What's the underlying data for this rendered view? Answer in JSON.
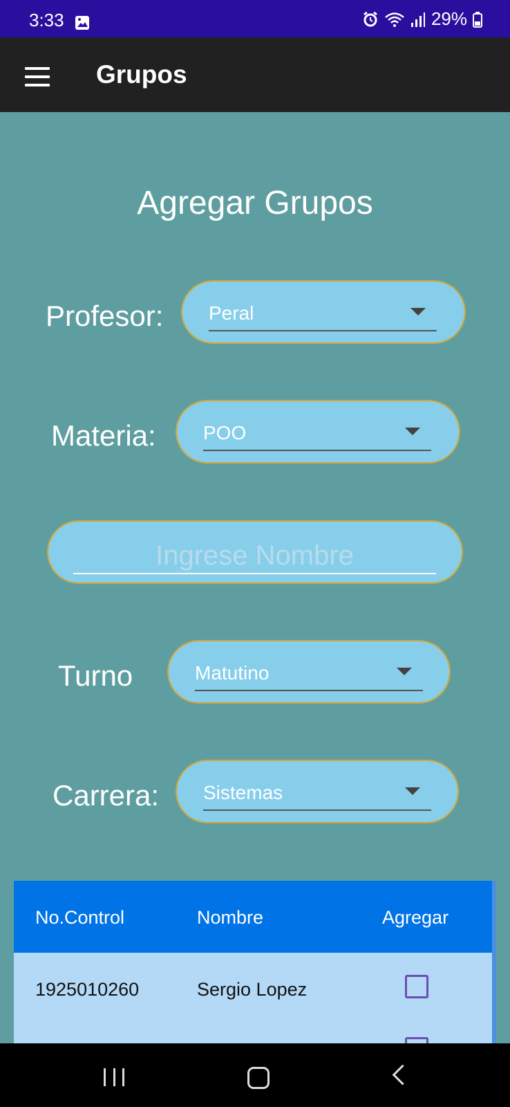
{
  "status": {
    "time": "3:33",
    "battery": "29%"
  },
  "app_bar": {
    "title": "Grupos"
  },
  "form": {
    "title": "Agregar Grupos",
    "profesor_label": "Profesor:",
    "profesor_value": "Peral",
    "materia_label": "Materia:",
    "materia_value": "POO",
    "nombre_placeholder": "Ingrese Nombre",
    "nombre_value": "",
    "turno_label": "Turno",
    "turno_value": "Matutino",
    "carrera_label": "Carrera:",
    "carrera_value": "Sistemas"
  },
  "table": {
    "headers": [
      "No.Control",
      "Nombre",
      "Agregar"
    ],
    "rows": [
      {
        "control": "1925010260",
        "nombre": "Sergio Lopez",
        "agregar": false
      },
      {
        "control": "",
        "nombre": "",
        "agregar": false
      }
    ]
  },
  "colors": {
    "background": "#5f9ea0",
    "field": "#87ceeb",
    "header": "#0073e6",
    "row": "#b3d9f7",
    "border": "#d4a637"
  },
  "icons": [
    "menu-icon",
    "gallery-icon",
    "alarm-icon",
    "wifi-icon",
    "signal-icon",
    "battery-icon",
    "dropdown-arrow-icon",
    "checkbox-icon"
  ]
}
